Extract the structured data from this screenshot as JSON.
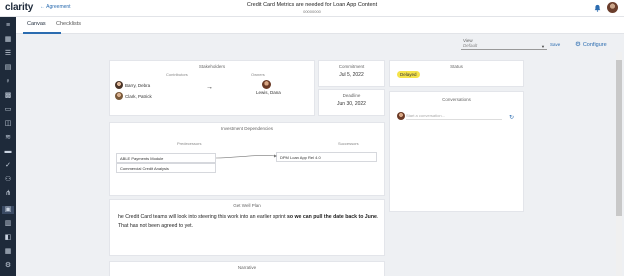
{
  "header": {
    "logo": "clarity",
    "back_label": "← Agreement",
    "title": "Credit Card Metrics are needed for Loan App Content",
    "subtitle": "00000000"
  },
  "tabs": [
    {
      "label": "Canvas",
      "active": true
    },
    {
      "label": "Checklists",
      "active": false
    }
  ],
  "view": {
    "label": "View",
    "selected": "Default",
    "save_label": "Save",
    "configure_label": "Configure"
  },
  "stakeholders": {
    "title": "Stakeholders",
    "contributors_label": "Contributors",
    "owners_label": "Owners",
    "contributors": [
      "Barry, Debra",
      "Clark, Patrick"
    ],
    "owners": [
      "Lewis, Dana"
    ]
  },
  "commitment": {
    "title": "Commitment",
    "value": "Jul 5, 2022"
  },
  "deadline": {
    "title": "Deadline",
    "value": "Jun 30, 2022"
  },
  "status": {
    "title": "Status",
    "value": "Delayed",
    "color": "#f5e34a"
  },
  "conversations": {
    "title": "Conversations",
    "placeholder": "Start a conversation..."
  },
  "dependencies": {
    "title": "Investment Dependencies",
    "predecessors_label": "Predecessors",
    "successors_label": "Successors",
    "predecessors": [
      "ABLE Payments Module",
      "Commercial Credit Analysis"
    ],
    "successors": [
      "DPM Loan App Rel 4.0"
    ]
  },
  "get_well": {
    "title": "Get Well Plan",
    "text_before": "he Credit Card teams will look into steering this work into an earlier sprint ",
    "text_bold": "so we can pull the date back to June",
    "text_after": ".  That has not been agreed to yet."
  },
  "narrative": {
    "title": "Narrative"
  },
  "colors": {
    "accent": "#2b6cb0",
    "sidebar": "#1e2a3a"
  }
}
